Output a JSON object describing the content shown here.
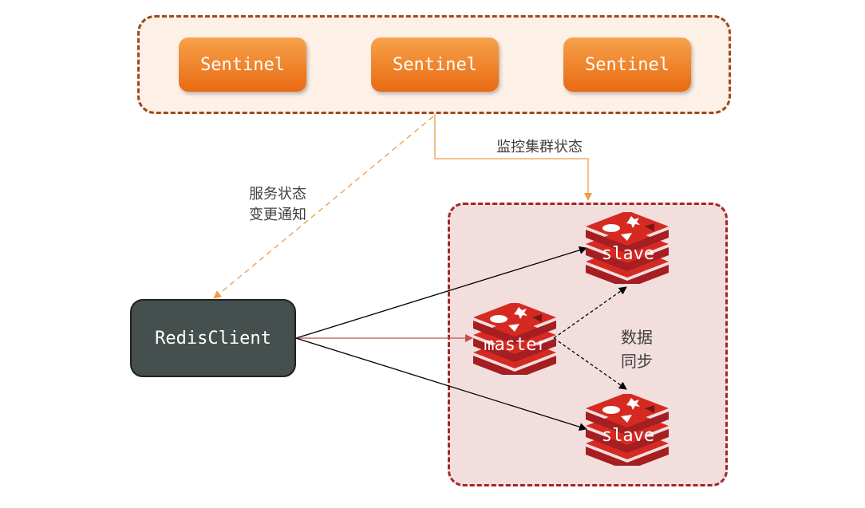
{
  "sentinels": [
    {
      "label": "Sentinel"
    },
    {
      "label": "Sentinel"
    },
    {
      "label": "Sentinel"
    }
  ],
  "labels": {
    "monitor": "监控集群状态",
    "notify_line1": "服务状态",
    "notify_line2": "变更通知",
    "sync_line1": "数据",
    "sync_line2": "同步"
  },
  "client": {
    "label": "RedisClient"
  },
  "nodes": {
    "slave_top": "slave",
    "master": "master",
    "slave_bottom": "slave"
  },
  "colors": {
    "sentinel_fill": "#ee7d22",
    "sentinel_border": "#9b4a1f",
    "cluster_border": "#a42626",
    "redis_red": "#d52a22",
    "client_fill": "#454f4d",
    "notify_arrow": "#f19a4a",
    "master_arrow": "#c0504d"
  }
}
